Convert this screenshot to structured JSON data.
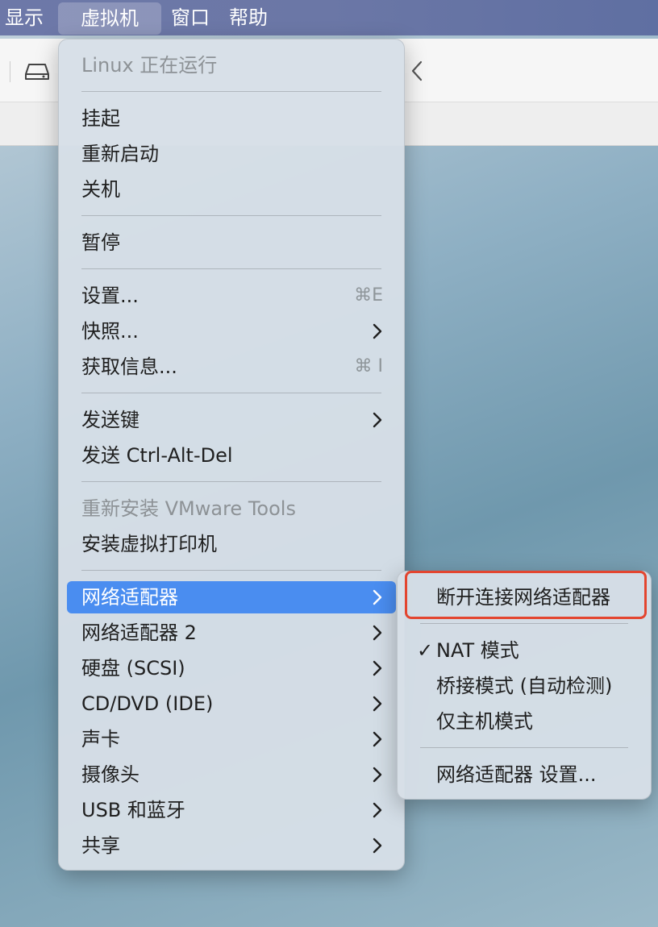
{
  "menubar": {
    "items": [
      "显示",
      "虚拟机",
      "窗口",
      "帮助"
    ],
    "active_index": 1
  },
  "vm_menu": {
    "status": "Linux 正在运行",
    "suspend": "挂起",
    "restart": "重新启动",
    "shutdown": "关机",
    "pause": "暂停",
    "settings": "设置...",
    "settings_shortcut": "⌘E",
    "snapshot": "快照...",
    "get_info": "获取信息...",
    "get_info_shortcut": "⌘ I",
    "send_key": "发送键",
    "send_ctrl_alt_del": "发送 Ctrl-Alt-Del",
    "reinstall_tools": "重新安装 VMware Tools",
    "install_printer": "安装虚拟打印机",
    "network_adapter": "网络适配器",
    "network_adapter_2": "网络适配器 2",
    "hard_disk": "硬盘 (SCSI)",
    "cd_dvd": "CD/DVD (IDE)",
    "sound_card": "声卡",
    "camera": "摄像头",
    "usb_bluetooth": "USB 和蓝牙",
    "sharing": "共享"
  },
  "network_submenu": {
    "disconnect": "断开连接网络适配器",
    "check_mark": "✓",
    "nat_mode": "NAT 模式",
    "bridged_mode": "桥接模式 (自动检测)",
    "host_only": "仅主机模式",
    "adapter_settings": "网络适配器 设置..."
  },
  "colors": {
    "highlight": "#4a8df0",
    "annotation_box": "#e3452f"
  }
}
